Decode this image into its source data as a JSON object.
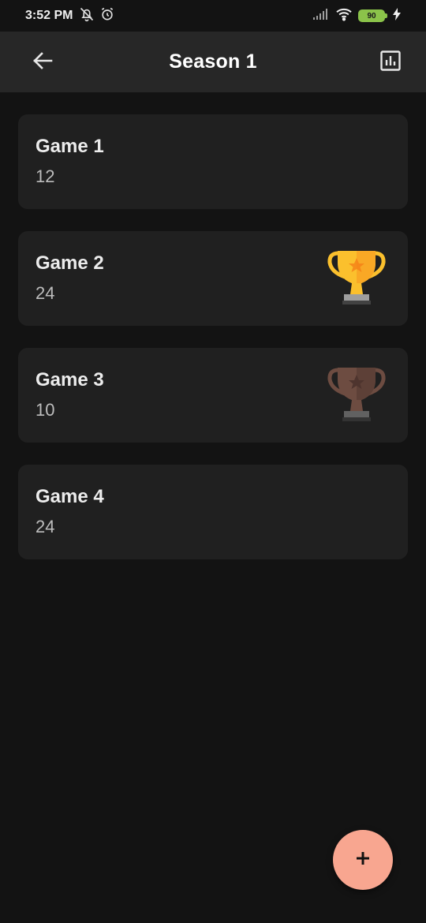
{
  "status_bar": {
    "time": "3:52 PM",
    "battery": "90",
    "icons": [
      "notifications-off-icon",
      "alarm-icon",
      "signal-icon",
      "wifi-icon",
      "battery-icon",
      "charging-icon"
    ]
  },
  "app_bar": {
    "title": "Season 1",
    "back_icon": "arrow-back-icon",
    "stats_icon": "bar-chart-icon"
  },
  "games": [
    {
      "name": "Game 1",
      "score": "12",
      "trophy": "none"
    },
    {
      "name": "Game 2",
      "score": "24",
      "trophy": "gold"
    },
    {
      "name": "Game 3",
      "score": "10",
      "trophy": "bronze"
    },
    {
      "name": "Game 4",
      "score": "24",
      "trophy": "none"
    }
  ],
  "fab": {
    "label": "+",
    "icon": "add-icon"
  },
  "colors": {
    "background": "#131313",
    "app_bar": "#272727",
    "card": "#202020",
    "fab": "#f8a690",
    "gold_trophy": "#fbc02d",
    "bronze_trophy": "#6d4c41",
    "battery": "#8bc34a"
  }
}
